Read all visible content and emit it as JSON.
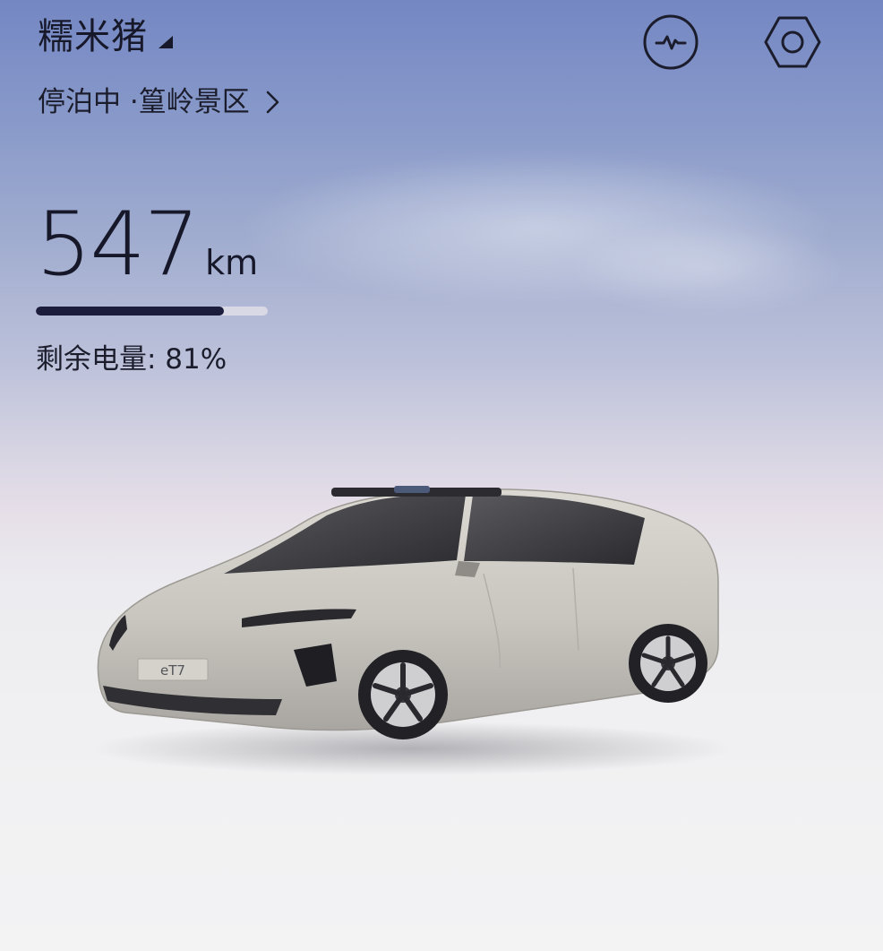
{
  "header": {
    "car_name": "糯米猪",
    "status_prefix": "停泊中 · ",
    "location": "篁岭景区"
  },
  "vehicle": {
    "range_value": "547",
    "range_unit": "km",
    "battery_label": "剩余电量: 81%",
    "battery_percent": 81,
    "model_badge": "eT7",
    "paint_color": "#c9c6c1"
  },
  "icons": {
    "caret": "caret-down-right-icon",
    "status_chevron": "chevron-right-icon",
    "activity": "activity-pulse-icon",
    "settings": "hexagon-settings-icon"
  },
  "colors": {
    "text": "#17192a",
    "battery_fill": "#1c1c3c",
    "battery_track": "#e0dee8"
  }
}
